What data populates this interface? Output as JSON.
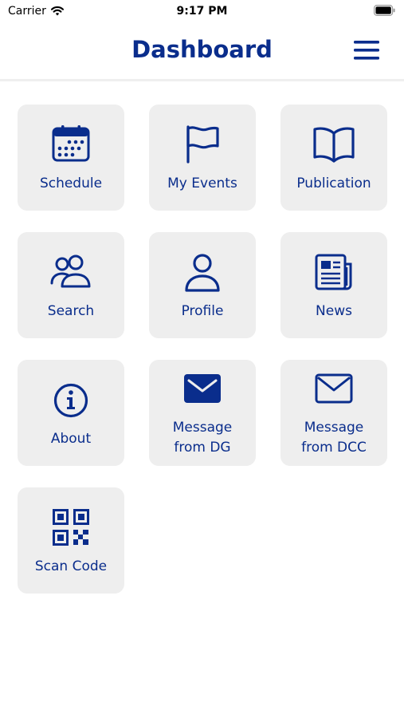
{
  "status_bar": {
    "carrier": "Carrier",
    "time": "9:17 PM",
    "icons": [
      "wifi-icon",
      "battery-icon"
    ]
  },
  "header": {
    "title": "Dashboard",
    "menu_icon": "hamburger-menu-icon"
  },
  "colors": {
    "accent": "#0a2d8c",
    "tile_background": "#eeeeee",
    "page_background": "#ffffff"
  },
  "tiles": [
    {
      "label": "Schedule",
      "icon": "calendar-icon"
    },
    {
      "label": "My Events",
      "icon": "flag-icon"
    },
    {
      "label": "Publication",
      "icon": "open-book-icon"
    },
    {
      "label": "Search",
      "icon": "users-icon"
    },
    {
      "label": "Profile",
      "icon": "user-icon"
    },
    {
      "label": "News",
      "icon": "newspaper-icon"
    },
    {
      "label": "About",
      "icon": "info-icon"
    },
    {
      "label_line1": "Message",
      "label_line2": "from DG",
      "icon": "envelope-filled-icon"
    },
    {
      "label_line1": "Message",
      "label_line2": "from DCC",
      "icon": "envelope-outline-icon"
    },
    {
      "label": "Scan Code",
      "icon": "qr-code-icon"
    }
  ]
}
